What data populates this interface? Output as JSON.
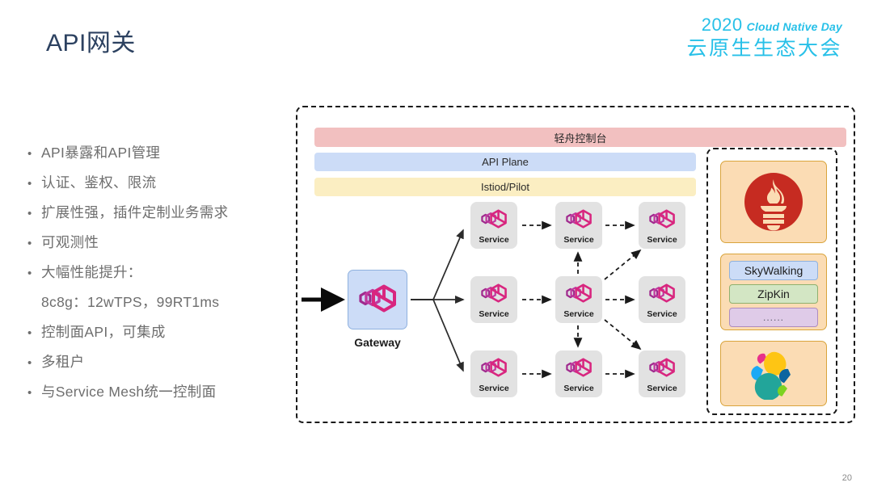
{
  "page_title": "API网关",
  "brand": {
    "year": "2020",
    "english": "Cloud Native Day",
    "chinese": "云原生生态大会",
    "color": "#27c0e8"
  },
  "bullets": [
    {
      "text": "API暴露和API管理",
      "sub": false
    },
    {
      "text": "认证、鉴权、限流",
      "sub": false
    },
    {
      "text": "扩展性强，插件定制业务需求",
      "sub": false
    },
    {
      "text": "可观测性",
      "sub": false
    },
    {
      "text": "大幅性能提升：",
      "sub": false
    },
    {
      "text": "8c8g：12wTPS，99RT1ms",
      "sub": true
    },
    {
      "text": "控制面API，可集成",
      "sub": false
    },
    {
      "text": "多租户",
      "sub": false
    },
    {
      "text": "与Service Mesh统一控制面",
      "sub": false
    }
  ],
  "diagram": {
    "bands": [
      {
        "id": "console",
        "label": "轻舟控制台",
        "color": "#f2c0c0"
      },
      {
        "id": "apiplane",
        "label": "API Plane",
        "color": "#ccdcf7"
      },
      {
        "id": "istiod",
        "label": "Istiod/Pilot",
        "color": "#fbeec2"
      }
    ],
    "gateway": {
      "label": "Gateway",
      "icon": "cube-hexagon-icon",
      "color": "#ccdcf7"
    },
    "services": [
      {
        "id": "svc-r1c1",
        "label": "Service",
        "row": 1,
        "col": 1
      },
      {
        "id": "svc-r1c2",
        "label": "Service",
        "row": 1,
        "col": 2
      },
      {
        "id": "svc-r1c3",
        "label": "Service",
        "row": 1,
        "col": 3
      },
      {
        "id": "svc-r2c1",
        "label": "Service",
        "row": 2,
        "col": 1
      },
      {
        "id": "svc-r2c2",
        "label": "Service",
        "row": 2,
        "col": 2
      },
      {
        "id": "svc-r2c3",
        "label": "Service",
        "row": 2,
        "col": 3
      },
      {
        "id": "svc-r3c1",
        "label": "Service",
        "row": 3,
        "col": 1
      },
      {
        "id": "svc-r3c2",
        "label": "Service",
        "row": 3,
        "col": 2
      },
      {
        "id": "svc-r3c3",
        "label": "Service",
        "row": 3,
        "col": 3
      }
    ],
    "observability": {
      "prometheus": {
        "icon": "prometheus-logo",
        "color": "#c62b21"
      },
      "tracing_chips": [
        {
          "label": "SkyWalking",
          "color": "#ccdcf7"
        },
        {
          "label": "ZipKin",
          "color": "#d3e6c4"
        },
        {
          "label": "......",
          "color": "#dfcbe8"
        }
      ],
      "elastic": {
        "icon": "elastic-logo"
      }
    }
  },
  "page_number": "20"
}
